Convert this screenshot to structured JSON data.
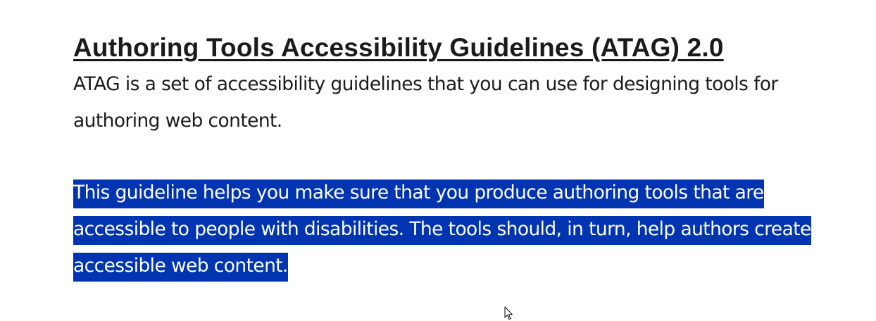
{
  "heading": "Authoring Tools Accessibility Guidelines (ATAG) 2.0",
  "intro": "ATAG is a set of accessibility guidelines that you can use for designing tools for authoring web content.",
  "selected_paragraph": "This guideline helps you make sure that you produce authoring tools that are accessible to people with disabilities.  The tools should, in turn, help authors create accessible web content.",
  "colors": {
    "text": "#1b1b1b",
    "selection_background": "#0034b0",
    "selection_text": "#ffffff"
  },
  "icons": {
    "cursor": "mouse-pointer-icon"
  }
}
